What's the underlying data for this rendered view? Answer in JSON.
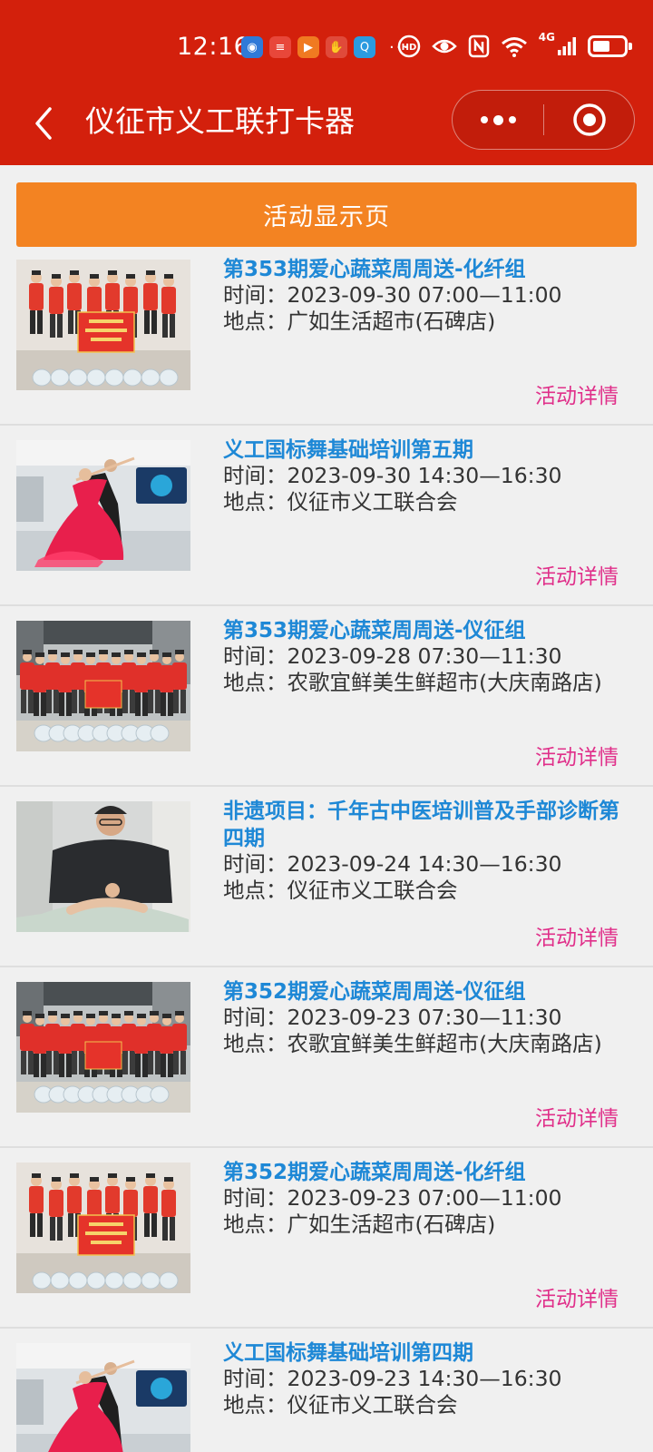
{
  "status_bar": {
    "time": "12:16",
    "app_icons": [
      {
        "name": "browser-app-icon",
        "color": "#2f7ad8",
        "glyph": "◉"
      },
      {
        "name": "news-app-icon",
        "color": "#e8473a",
        "glyph": "≡"
      },
      {
        "name": "video-app-icon",
        "color": "#f07a21",
        "glyph": "▶"
      },
      {
        "name": "hand-app-icon",
        "color": "#e04a3a",
        "glyph": "✋"
      },
      {
        "name": "search-app-icon",
        "color": "#2b9be0",
        "glyph": "Q"
      }
    ],
    "more_dots": "···",
    "network_label": "4G",
    "battery_level_percent": 55
  },
  "nav": {
    "title": "仪征市义工联打卡器"
  },
  "page_button": "活动显示页",
  "activities": [
    {
      "title": "第353期爱心蔬菜周周送-化纤组",
      "time": "时间：2023-09-30 07:00—11:00",
      "place": "地点：广如生活超市(石碑店)",
      "detail": "活动详情",
      "photo": "group-banner-photo"
    },
    {
      "title": "义工国标舞基础培训第五期",
      "time": "时间：2023-09-30 14:30—16:30",
      "place": "地点：仪征市义工联合会",
      "detail": "活动详情",
      "photo": "dance-photo"
    },
    {
      "title": "第353期爱心蔬菜周周送-仪征组",
      "time": "时间：2023-09-28 07:30—11:30",
      "place": "地点：农歌宜鲜美生鲜超市(大庆南路店)",
      "detail": "活动详情",
      "photo": "supermarket-group-photo"
    },
    {
      "title": "非遗项目：千年古中医培训普及手部诊断第四期",
      "time": "时间：2023-09-24 14:30—16:30",
      "place": "地点：仪征市义工联合会",
      "detail": "活动详情",
      "photo": "hand-diagnosis-photo"
    },
    {
      "title": "第352期爱心蔬菜周周送-仪征组",
      "time": "时间：2023-09-23 07:30—11:30",
      "place": "地点：农歌宜鲜美生鲜超市(大庆南路店)",
      "detail": "活动详情",
      "photo": "supermarket-group-photo"
    },
    {
      "title": "第352期爱心蔬菜周周送-化纤组",
      "time": "时间：2023-09-23 07:00—11:00",
      "place": "地点：广如生活超市(石碑店)",
      "detail": "活动详情",
      "photo": "group-banner-photo"
    },
    {
      "title": "义工国标舞基础培训第四期",
      "time": "时间：2023-09-23 14:30—16:30",
      "place": "地点：仪征市义工联合会",
      "detail": "活动详情",
      "photo": "dance-photo"
    }
  ],
  "colors": {
    "header": "#d3200c",
    "button": "#f38322",
    "title_blue": "#1e88d6",
    "detail_pink": "#e0308a"
  }
}
